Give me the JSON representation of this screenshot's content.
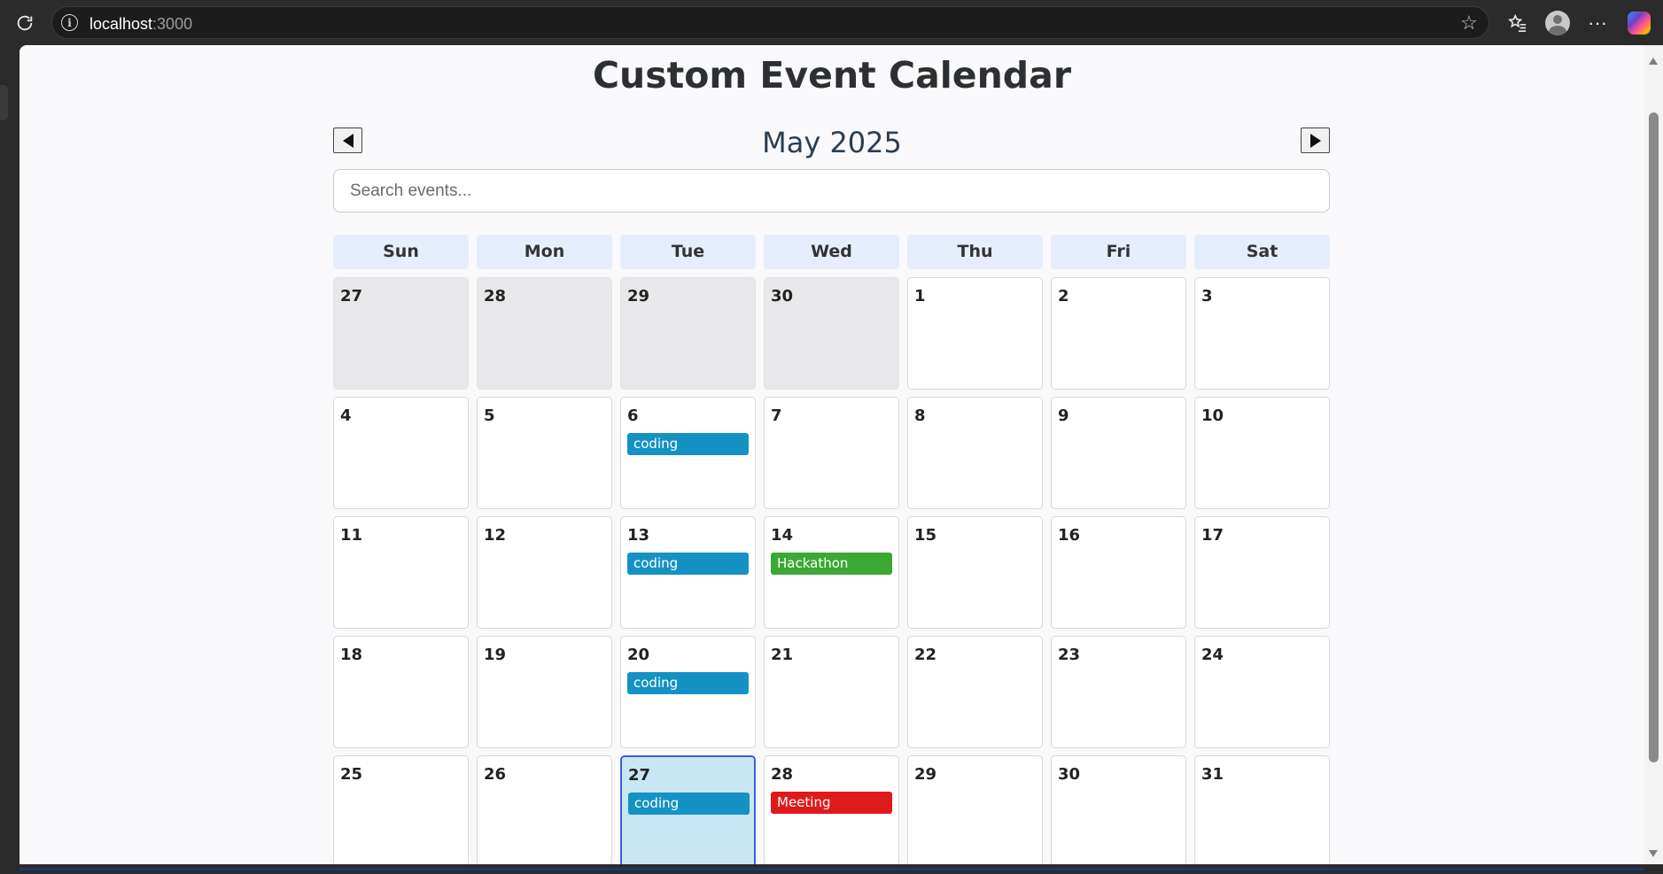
{
  "browser": {
    "url_host": "localhost",
    "url_port": ":3000"
  },
  "page": {
    "title": "Custom Event Calendar",
    "month_label": "May 2025",
    "search_placeholder": "Search events...",
    "prev_label": "◀",
    "next_label": "▶"
  },
  "weekdays": [
    "Sun",
    "Mon",
    "Tue",
    "Wed",
    "Thu",
    "Fri",
    "Sat"
  ],
  "colors": {
    "coding": "#1592c4",
    "hackathon": "#3aa832",
    "meeting": "#e01a1a",
    "selected_bg": "#c9e6f5",
    "selected_border": "#3a5fd6"
  },
  "weeks": [
    [
      {
        "day": "27",
        "other": true
      },
      {
        "day": "28",
        "other": true
      },
      {
        "day": "29",
        "other": true
      },
      {
        "day": "30",
        "other": true
      },
      {
        "day": "1"
      },
      {
        "day": "2"
      },
      {
        "day": "3"
      }
    ],
    [
      {
        "day": "4"
      },
      {
        "day": "5"
      },
      {
        "day": "6",
        "events": [
          {
            "title": "coding",
            "color": "#1592c4"
          }
        ]
      },
      {
        "day": "7"
      },
      {
        "day": "8"
      },
      {
        "day": "9"
      },
      {
        "day": "10"
      }
    ],
    [
      {
        "day": "11"
      },
      {
        "day": "12"
      },
      {
        "day": "13",
        "events": [
          {
            "title": "coding",
            "color": "#1592c4"
          }
        ]
      },
      {
        "day": "14",
        "events": [
          {
            "title": "Hackathon",
            "color": "#3aa832"
          }
        ]
      },
      {
        "day": "15"
      },
      {
        "day": "16"
      },
      {
        "day": "17"
      }
    ],
    [
      {
        "day": "18"
      },
      {
        "day": "19"
      },
      {
        "day": "20",
        "events": [
          {
            "title": "coding",
            "color": "#1592c4"
          }
        ]
      },
      {
        "day": "21"
      },
      {
        "day": "22"
      },
      {
        "day": "23"
      },
      {
        "day": "24"
      }
    ],
    [
      {
        "day": "25"
      },
      {
        "day": "26"
      },
      {
        "day": "27",
        "selected": true,
        "events": [
          {
            "title": "coding",
            "color": "#1592c4"
          }
        ]
      },
      {
        "day": "28",
        "events": [
          {
            "title": "Meeting",
            "color": "#e01a1a"
          }
        ]
      },
      {
        "day": "29"
      },
      {
        "day": "30"
      },
      {
        "day": "31"
      }
    ]
  ]
}
